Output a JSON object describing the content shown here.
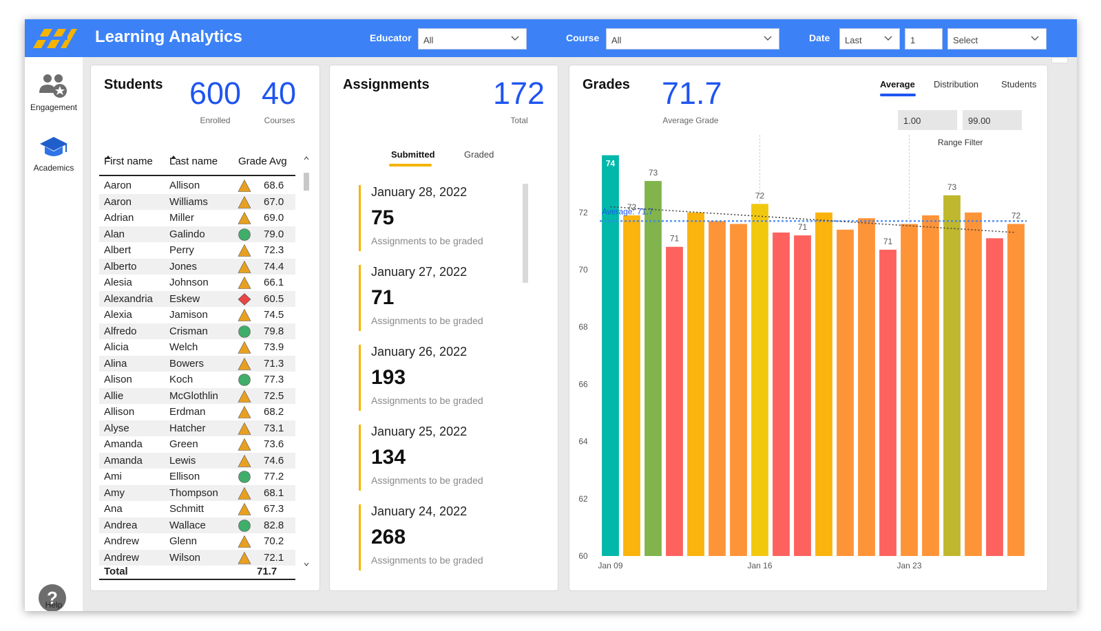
{
  "header": {
    "title": "Learning Analytics",
    "educator_label": "Educator",
    "educator_value": "All",
    "course_label": "Course",
    "course_value": "All",
    "date_label": "Date",
    "date_mode": "Last",
    "date_count": "1",
    "date_unit": "Select",
    "accent": "#3c82f6"
  },
  "sidebar": {
    "items": [
      {
        "label": "Engagement",
        "icon": "people-icon"
      },
      {
        "label": "Academics",
        "icon": "graduation-cap-icon"
      }
    ],
    "help_label": "Help",
    "help_glyph": "?"
  },
  "students": {
    "title": "Students",
    "enrolled_value": "600",
    "enrolled_label": "Enrolled",
    "courses_value": "40",
    "courses_label": "Courses",
    "columns": [
      "First name",
      "Last name",
      "Grade Avg"
    ],
    "rows": [
      {
        "first": "Aaron",
        "last": "Allison",
        "status": "triangle",
        "grade": "68.6"
      },
      {
        "first": "Aaron",
        "last": "Williams",
        "status": "triangle",
        "grade": "67.0"
      },
      {
        "first": "Adrian",
        "last": "Miller",
        "status": "triangle",
        "grade": "69.0"
      },
      {
        "first": "Alan",
        "last": "Galindo",
        "status": "circle",
        "grade": "79.0"
      },
      {
        "first": "Albert",
        "last": "Perry",
        "status": "triangle",
        "grade": "72.3"
      },
      {
        "first": "Alberto",
        "last": "Jones",
        "status": "triangle",
        "grade": "74.4"
      },
      {
        "first": "Alesia",
        "last": "Johnson",
        "status": "triangle",
        "grade": "66.1"
      },
      {
        "first": "Alexandria",
        "last": "Eskew",
        "status": "diamond",
        "grade": "60.5"
      },
      {
        "first": "Alexia",
        "last": "Jamison",
        "status": "triangle",
        "grade": "74.5"
      },
      {
        "first": "Alfredo",
        "last": "Crisman",
        "status": "circle",
        "grade": "79.8"
      },
      {
        "first": "Alicia",
        "last": "Welch",
        "status": "triangle",
        "grade": "73.9"
      },
      {
        "first": "Alina",
        "last": "Bowers",
        "status": "triangle",
        "grade": "71.3"
      },
      {
        "first": "Alison",
        "last": "Koch",
        "status": "circle",
        "grade": "77.3"
      },
      {
        "first": "Allie",
        "last": "McGlothlin",
        "status": "triangle",
        "grade": "72.5"
      },
      {
        "first": "Allison",
        "last": "Erdman",
        "status": "triangle",
        "grade": "68.2"
      },
      {
        "first": "Alyse",
        "last": "Hatcher",
        "status": "triangle",
        "grade": "73.1"
      },
      {
        "first": "Amanda",
        "last": "Green",
        "status": "triangle",
        "grade": "73.6"
      },
      {
        "first": "Amanda",
        "last": "Lewis",
        "status": "triangle",
        "grade": "74.6"
      },
      {
        "first": "Ami",
        "last": "Ellison",
        "status": "circle",
        "grade": "77.2"
      },
      {
        "first": "Amy",
        "last": "Thompson",
        "status": "triangle",
        "grade": "68.1"
      },
      {
        "first": "Ana",
        "last": "Schmitt",
        "status": "triangle",
        "grade": "67.3"
      },
      {
        "first": "Andrea",
        "last": "Wallace",
        "status": "circle",
        "grade": "82.8"
      },
      {
        "first": "Andrew",
        "last": "Glenn",
        "status": "triangle",
        "grade": "70.2"
      },
      {
        "first": "Andrew",
        "last": "Wilson",
        "status": "triangle",
        "grade": "72.1"
      }
    ],
    "total_label": "Total",
    "total_value": "71.7",
    "status_colors": {
      "triangle": "#e8a021",
      "circle": "#3fae6a",
      "diamond": "#e84545"
    }
  },
  "assignments": {
    "title": "Assignments",
    "total_value": "172",
    "total_label": "Total",
    "tabs": [
      "Submitted",
      "Graded"
    ],
    "items": [
      {
        "date": "January 28, 2022",
        "count": "75",
        "label": "Assignments to be graded"
      },
      {
        "date": "January 27, 2022",
        "count": "71",
        "label": "Assignments to be graded"
      },
      {
        "date": "January 26, 2022",
        "count": "193",
        "label": "Assignments to be graded"
      },
      {
        "date": "January 25, 2022",
        "count": "134",
        "label": "Assignments to be graded"
      },
      {
        "date": "January 24, 2022",
        "count": "268",
        "label": "Assignments to be graded"
      }
    ]
  },
  "grades": {
    "title": "Grades",
    "avg_value": "71.7",
    "avg_label": "Average Grade",
    "tabs": [
      "Average",
      "Distribution",
      "Students"
    ],
    "range_min": "1.00",
    "range_max": "99.00",
    "range_label": "Range Filter"
  },
  "chart_data": {
    "type": "bar",
    "title": "",
    "ylim": [
      60,
      74.7
    ],
    "yticks": [
      60,
      62,
      64,
      66,
      68,
      70,
      72
    ],
    "xtick_labels": [
      {
        "index": 0,
        "label": "Jan 09"
      },
      {
        "index": 7,
        "label": "Jan 16"
      },
      {
        "index": 14,
        "label": "Jan 23"
      }
    ],
    "values": [
      74,
      71.9,
      73.1,
      70.8,
      72.0,
      71.7,
      71.6,
      72.3,
      71.3,
      71.2,
      72.0,
      71.4,
      71.8,
      70.7,
      71.6,
      71.9,
      72.6,
      72.0,
      71.1,
      71.6
    ],
    "bar_labels": [
      {
        "index": 0,
        "text": "74"
      },
      {
        "index": 1,
        "text": "72"
      },
      {
        "index": 2,
        "text": "73"
      },
      {
        "index": 3,
        "text": "71"
      },
      {
        "index": 7,
        "text": "72"
      },
      {
        "index": 9,
        "text": "71"
      },
      {
        "index": 13,
        "text": "71"
      },
      {
        "index": 16,
        "text": "73"
      },
      {
        "index": 19,
        "text": "72"
      }
    ],
    "colors": [
      "#01b8aa",
      "#fbb30d",
      "#81b44c",
      "#fd625e",
      "#fbb30d",
      "#fe9438",
      "#fe9438",
      "#f2c80f",
      "#fd625e",
      "#fd625e",
      "#fbb30d",
      "#fe9438",
      "#fe9438",
      "#fd625e",
      "#fe9438",
      "#fe9438",
      "#bfb72d",
      "#fe9438",
      "#fd625e",
      "#fe9438"
    ],
    "average_line": {
      "value": 71.7,
      "label": "Average: 71.7",
      "color": "#3c82f6"
    },
    "trend_line": {
      "start": 72.2,
      "end": 71.3,
      "color": "#444444"
    },
    "dotted_verticals": [
      7,
      14
    ]
  }
}
